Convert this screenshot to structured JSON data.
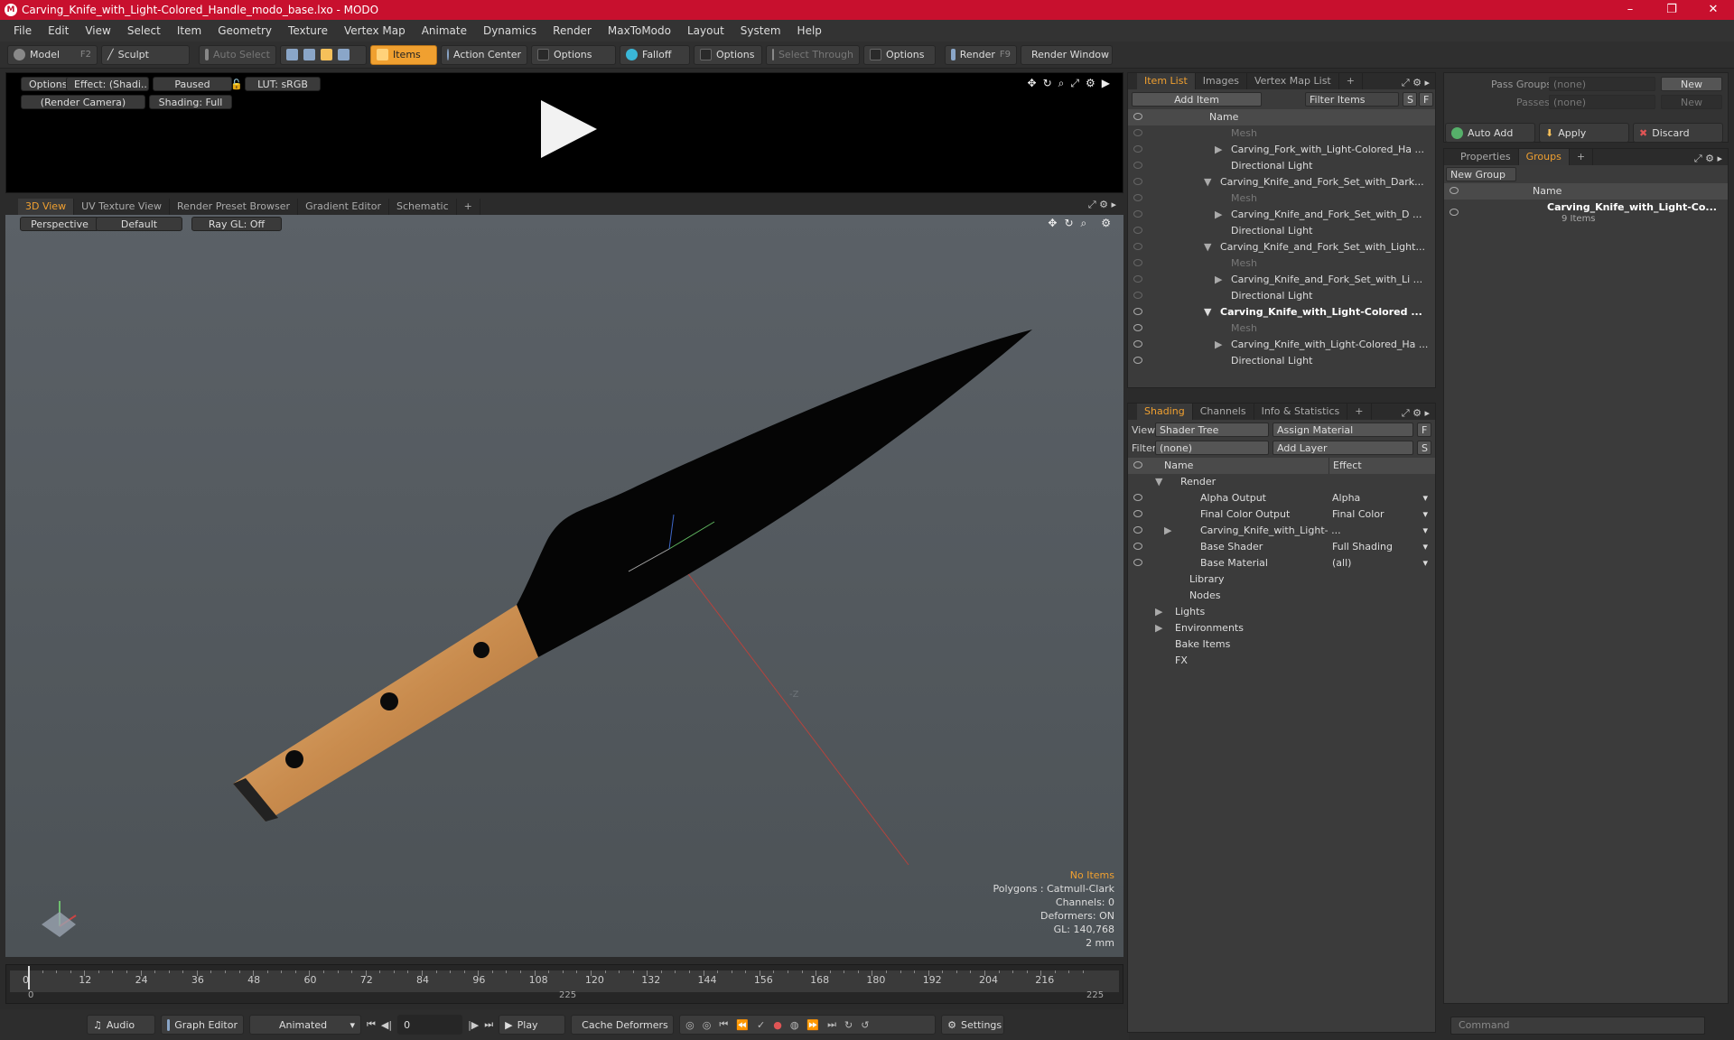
{
  "window": {
    "title": "Carving_Knife_with_Light-Colored_Handle_modo_base.lxo - MODO",
    "controls": [
      "–",
      "❐",
      "✕"
    ]
  },
  "menu": [
    "File",
    "Edit",
    "View",
    "Select",
    "Item",
    "Geometry",
    "Texture",
    "Vertex Map",
    "Animate",
    "Dynamics",
    "Render",
    "MaxToModo",
    "Layout",
    "System",
    "Help"
  ],
  "toolbar": {
    "model": "Model",
    "model_key": "F2",
    "sculpt": "Sculpt",
    "auto_select": "Auto Select",
    "items": "Items",
    "action_center": "Action Center",
    "options1": "Options",
    "falloff": "Falloff",
    "options2": "Options",
    "select_through": "Select Through",
    "options3": "Options",
    "render": "Render",
    "render_key": "F9",
    "render_window": "Render Window"
  },
  "preview": {
    "options": "Options",
    "effect": "Effect: (Shadi...",
    "paused": "Paused",
    "lut": "LUT: sRGB",
    "camera": "(Render Camera)",
    "shading": "Shading: Full"
  },
  "viewtabs": [
    "3D View",
    "UV Texture View",
    "Render Preset Browser",
    "Gradient Editor",
    "Schematic",
    "+"
  ],
  "view3d": {
    "perspective": "Perspective",
    "default": "Default",
    "raygl": "Ray GL: Off",
    "axis_label": "-Z",
    "info": {
      "no_items": "No Items",
      "polygons": "Polygons : Catmull-Clark",
      "channels": "Channels: 0",
      "deformers": "Deformers: ON",
      "gl": "GL: 140,768",
      "unit": "2 mm"
    }
  },
  "timeline": {
    "ticks": [
      "0",
      "12",
      "24",
      "36",
      "48",
      "60",
      "72",
      "84",
      "96",
      "108",
      "120",
      "132",
      "144",
      "156",
      "168",
      "180",
      "192",
      "204",
      "216"
    ],
    "start": "0",
    "mid": "225",
    "end": "225"
  },
  "bottombar": {
    "audio": "Audio",
    "graph_editor": "Graph Editor",
    "animated": "Animated",
    "frame": "0",
    "play": "Play",
    "cache": "Cache Deformers",
    "settings": "Settings"
  },
  "itemlist": {
    "tabs": [
      "Item List",
      "Images",
      "Vertex Map List",
      "+"
    ],
    "add_item": "Add Item",
    "filter": "Filter Items",
    "s": "S",
    "f": "F",
    "col_name": "Name",
    "rows": [
      {
        "label": "Mesh",
        "indent": 2,
        "dim": true
      },
      {
        "label": "Carving_Fork_with_Light-Colored_Ha ...",
        "indent": 2,
        "arrow": "▶"
      },
      {
        "label": "Directional Light",
        "indent": 2
      },
      {
        "label": "Carving_Knife_and_Fork_Set_with_Dark...",
        "indent": 1,
        "arrow": "▼"
      },
      {
        "label": "Mesh",
        "indent": 2,
        "dim": true
      },
      {
        "label": "Carving_Knife_and_Fork_Set_with_D ...",
        "indent": 2,
        "arrow": "▶"
      },
      {
        "label": "Directional Light",
        "indent": 2
      },
      {
        "label": "Carving_Knife_and_Fork_Set_with_Light...",
        "indent": 1,
        "arrow": "▼"
      },
      {
        "label": "Mesh",
        "indent": 2,
        "dim": true
      },
      {
        "label": "Carving_Knife_and_Fork_Set_with_Li ...",
        "indent": 2,
        "arrow": "▶"
      },
      {
        "label": "Directional Light",
        "indent": 2
      },
      {
        "label": "Carving_Knife_with_Light-Colored ...",
        "indent": 1,
        "arrow": "▼",
        "bold": true
      },
      {
        "label": "Mesh",
        "indent": 2,
        "dim": true
      },
      {
        "label": "Carving_Knife_with_Light-Colored_Ha ...",
        "indent": 2,
        "arrow": "▶"
      },
      {
        "label": "Directional Light",
        "indent": 2
      }
    ]
  },
  "shading": {
    "tabs": [
      "Shading",
      "Channels",
      "Info & Statistics",
      "+"
    ],
    "view_label": "View",
    "view_value": "Shader Tree",
    "assign": "Assign Material",
    "f": "F",
    "filter_label": "Filter",
    "filter_value": "(none)",
    "add_layer": "Add Layer",
    "s": "S",
    "col_name": "Name",
    "col_effect": "Effect",
    "rows": [
      {
        "label": "Render",
        "effect": "",
        "indent": 1,
        "arrow": "▼"
      },
      {
        "label": "Alpha Output",
        "effect": "Alpha",
        "indent": 2
      },
      {
        "label": "Final Color Output",
        "effect": "Final Color",
        "indent": 2
      },
      {
        "label": "Carving_Knife_with_Light- ...",
        "effect": "",
        "indent": 2,
        "arrow": "▶"
      },
      {
        "label": "Base Shader",
        "effect": "Full Shading",
        "indent": 2
      },
      {
        "label": "Base Material",
        "effect": "(all)",
        "indent": 2
      },
      {
        "label": "Library",
        "effect": "",
        "indent": 1
      },
      {
        "label": "Nodes",
        "effect": "",
        "indent": 1
      },
      {
        "label": "Lights",
        "effect": "",
        "indent": 0,
        "arrow": "▶"
      },
      {
        "label": "Environments",
        "effect": "",
        "indent": 0,
        "arrow": "▶"
      },
      {
        "label": "Bake Items",
        "effect": "",
        "indent": 0
      },
      {
        "label": "FX",
        "effect": "",
        "indent": 0
      }
    ]
  },
  "passgroups": {
    "pass_groups": "Pass Groups",
    "passes": "Passes",
    "none1": "(none)",
    "none2": "(none)",
    "new1": "New",
    "new2": "New",
    "auto_add": "Auto Add",
    "apply": "Apply",
    "discard": "Discard"
  },
  "groups": {
    "tabs": [
      "Properties",
      "Groups",
      "+"
    ],
    "new_group": "New Group",
    "col_name": "Name",
    "group_name": "Carving_Knife_with_Light-Co...",
    "group_count": "9 Items"
  },
  "command": {
    "placeholder": "Command"
  }
}
